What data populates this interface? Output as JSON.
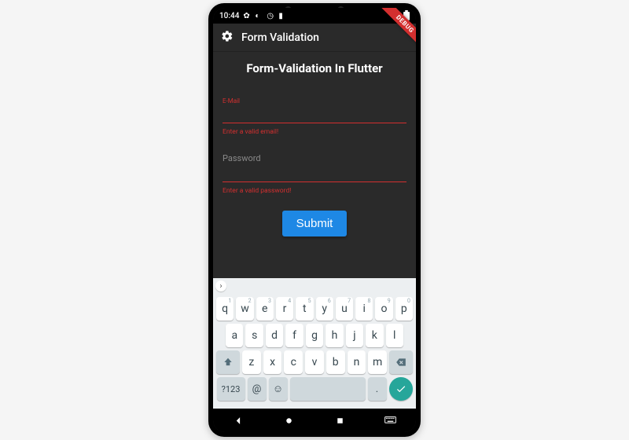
{
  "status": {
    "time": "10:44",
    "icons": [
      "gear",
      "shield",
      "clock",
      "battery"
    ]
  },
  "debug_banner": "DEBUG",
  "appbar": {
    "icon": "gear-icon",
    "title": "Form Validation"
  },
  "page": {
    "heading": "Form-Validation In Flutter"
  },
  "form": {
    "email": {
      "label": "E-Mail",
      "value": "",
      "error": "Enter a valid email!"
    },
    "password": {
      "label": "Password",
      "value": "",
      "error": "Enter a valid password!"
    },
    "submit_label": "Submit"
  },
  "keyboard": {
    "suggestion_chevron": "›",
    "row1": [
      {
        "k": "q",
        "d": "1"
      },
      {
        "k": "w",
        "d": "2"
      },
      {
        "k": "e",
        "d": "3"
      },
      {
        "k": "r",
        "d": "4"
      },
      {
        "k": "t",
        "d": "5"
      },
      {
        "k": "y",
        "d": "6"
      },
      {
        "k": "u",
        "d": "7"
      },
      {
        "k": "i",
        "d": "8"
      },
      {
        "k": "o",
        "d": "9"
      },
      {
        "k": "p",
        "d": "0"
      }
    ],
    "row2": [
      "a",
      "s",
      "d",
      "f",
      "g",
      "h",
      "j",
      "k",
      "l"
    ],
    "row3": [
      "z",
      "x",
      "c",
      "v",
      "b",
      "n",
      "m"
    ],
    "sym_label": "?123",
    "at_label": "@",
    "emoji_label": "☺",
    "period_label": "."
  },
  "nav": {
    "back": "back",
    "home": "home",
    "recent": "recent",
    "keyboard": "keyboard"
  }
}
